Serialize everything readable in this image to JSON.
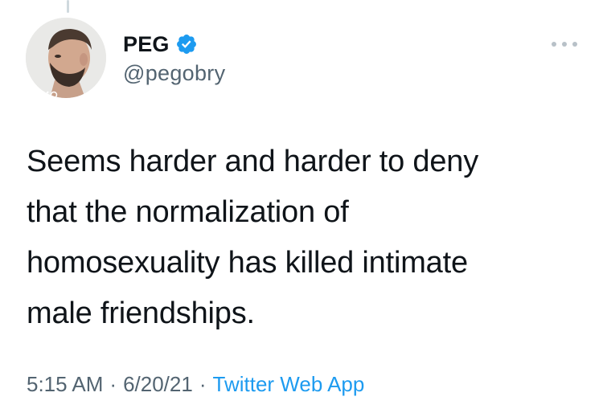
{
  "tweet": {
    "author": {
      "display_name": "PEG",
      "handle": "@pegobry",
      "verified": true,
      "avatar_icon": "profile-photo"
    },
    "text_lines": [
      "Seems harder and harder to deny",
      "that the normalization of",
      "homosexuality has killed intimate",
      "male friendships."
    ],
    "time": "5:15 AM",
    "separator": "·",
    "date": "6/20/21",
    "source": "Twitter Web App",
    "more_icon": "more-horizontal-icon"
  },
  "colors": {
    "verified_blue": "#1d9bf0",
    "link_blue": "#1d9bf0",
    "secondary_text": "#536471",
    "primary_text": "#0f1419"
  }
}
